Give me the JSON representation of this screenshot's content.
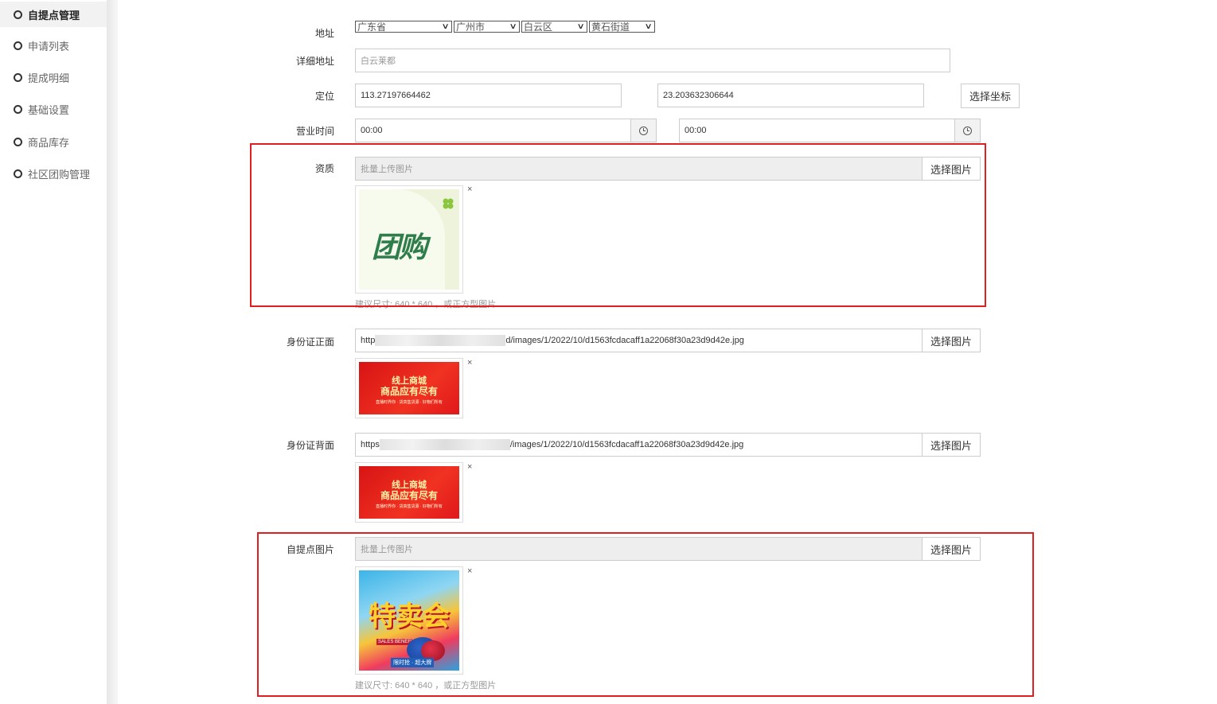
{
  "sidebar": {
    "items": [
      {
        "label": "自提点管理",
        "active": true
      },
      {
        "label": "申请列表",
        "active": false
      },
      {
        "label": "提成明细",
        "active": false
      },
      {
        "label": "基础设置",
        "active": false
      },
      {
        "label": "商品库存",
        "active": false
      },
      {
        "label": "社区团购管理",
        "active": false
      }
    ]
  },
  "form": {
    "address": {
      "label": "地址",
      "province": "广东省",
      "city": "广州市",
      "district": "白云区",
      "street": "黄石街道"
    },
    "detail_address": {
      "label": "详细地址",
      "placeholder": "白云莱都"
    },
    "location": {
      "label": "定位",
      "lng": "113.27197664462",
      "lat": "23.203632306644",
      "button": "选择坐标"
    },
    "business_hours": {
      "label": "营业时间",
      "start": "00:00",
      "end": "00:00"
    },
    "qualification": {
      "label": "资质",
      "placeholder": "批量上传图片",
      "button": "选择图片",
      "image_text": "团购",
      "hint": "建议尺寸: 640 * 640 ，或正方型图片"
    },
    "id_front": {
      "label": "身份证正面",
      "url_prefix": "http",
      "url_suffix": "d/images/1/2022/10/d1563fcdacaff1a22068f30a23d9d42e.jpg",
      "button": "选择图片",
      "image_line1": "线上商城",
      "image_line2": "商品应有尽有",
      "image_line3": "直播时界你 · 货真售货源 · 好物们所有"
    },
    "id_back": {
      "label": "身份证背面",
      "url_prefix": "https",
      "url_suffix": "/images/1/2022/10/d1563fcdacaff1a22068f30a23d9d42e.jpg",
      "button": "选择图片",
      "image_line1": "线上商城",
      "image_line2": "商品应有尽有",
      "image_line3": "直播时界你 · 货真售货源 · 好物们所有"
    },
    "pickup_image": {
      "label": "自提点图片",
      "placeholder": "批量上传图片",
      "button": "选择图片",
      "image_text": "特卖会",
      "image_small": "SALES BENEFITS",
      "image_tag": "限时抢 · 超大牌",
      "hint": "建议尺寸: 640 * 640 ，或正方型图片"
    },
    "remove_symbol": "×"
  },
  "colors": {
    "highlight_border": "#e02020",
    "sidebar_active_bg": "#f2f2f2"
  }
}
